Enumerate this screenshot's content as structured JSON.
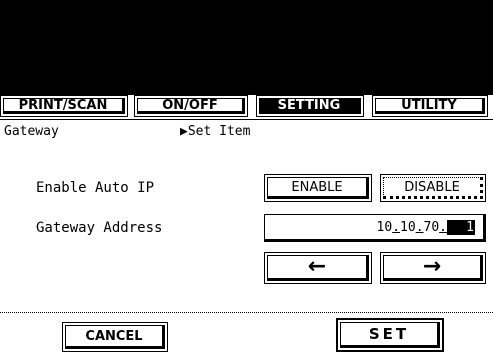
{
  "tabs": [
    {
      "label": "PRINT/SCAN",
      "active": false
    },
    {
      "label": "ON/OFF",
      "active": false
    },
    {
      "label": "SETTING",
      "active": true
    },
    {
      "label": "UTILITY",
      "active": false
    }
  ],
  "header": {
    "title": "Gateway",
    "marker": "▶",
    "subtitle": "Set Item"
  },
  "auto_ip": {
    "label": "Enable Auto IP",
    "enable_label": "ENABLE",
    "disable_label": "DISABLE",
    "selected": "DISABLE"
  },
  "gateway": {
    "label": "Gateway Address",
    "octet1": "10",
    "octet2": "10",
    "octet3": "70",
    "octet4": "1"
  },
  "nav": {
    "left_arrow": "←",
    "right_arrow": "→"
  },
  "footer": {
    "cancel_label": "CANCEL",
    "set_label": "SET"
  }
}
